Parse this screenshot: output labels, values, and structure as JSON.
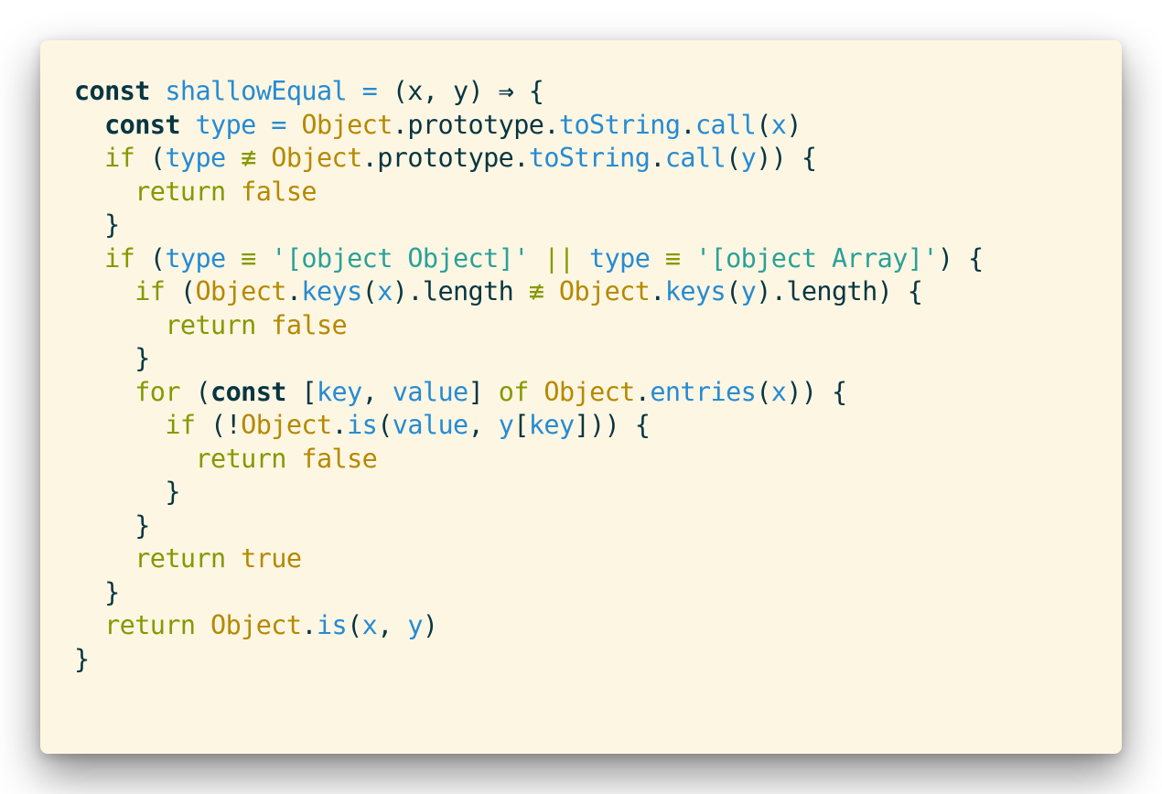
{
  "editor": {
    "language": "javascript",
    "theme": "solarized-light",
    "colors": {
      "background": "#fdf6e3",
      "keyword": "#073642",
      "control": "#859900",
      "object": "#b58900",
      "function": "#268bd2",
      "string": "#2aa198",
      "plain": "#073642"
    },
    "lines": [
      [
        [
          "kw",
          "const"
        ],
        [
          "pl",
          " "
        ],
        [
          "var",
          "shallowEqual"
        ],
        [
          "pl",
          " "
        ],
        [
          "fn",
          "="
        ],
        [
          "pl",
          " (x, y) "
        ],
        [
          "kw",
          "⇒"
        ],
        [
          "pl",
          " {"
        ]
      ],
      [
        [
          "pl",
          "  "
        ],
        [
          "kw",
          "const"
        ],
        [
          "pl",
          " "
        ],
        [
          "var",
          "type"
        ],
        [
          "pl",
          " "
        ],
        [
          "fn",
          "="
        ],
        [
          "pl",
          " "
        ],
        [
          "obj",
          "Object"
        ],
        [
          "pl",
          ".prototype."
        ],
        [
          "fn",
          "toString"
        ],
        [
          "pl",
          "."
        ],
        [
          "fn",
          "call"
        ],
        [
          "pl",
          "("
        ],
        [
          "var",
          "x"
        ],
        [
          "pl",
          ")"
        ]
      ],
      [
        [
          "pl",
          "  "
        ],
        [
          "ctl",
          "if"
        ],
        [
          "pl",
          " ("
        ],
        [
          "var",
          "type"
        ],
        [
          "pl",
          " "
        ],
        [
          "op",
          "≢"
        ],
        [
          "pl",
          " "
        ],
        [
          "obj",
          "Object"
        ],
        [
          "pl",
          ".prototype."
        ],
        [
          "fn",
          "toString"
        ],
        [
          "pl",
          "."
        ],
        [
          "fn",
          "call"
        ],
        [
          "pl",
          "("
        ],
        [
          "var",
          "y"
        ],
        [
          "pl",
          ")) {"
        ]
      ],
      [
        [
          "pl",
          "    "
        ],
        [
          "ctl",
          "return"
        ],
        [
          "pl",
          " "
        ],
        [
          "lit",
          "false"
        ]
      ],
      [
        [
          "pl",
          "  }"
        ]
      ],
      [
        [
          "pl",
          "  "
        ],
        [
          "ctl",
          "if"
        ],
        [
          "pl",
          " ("
        ],
        [
          "var",
          "type"
        ],
        [
          "pl",
          " "
        ],
        [
          "op",
          "≡"
        ],
        [
          "pl",
          " "
        ],
        [
          "str",
          "'[object Object]'"
        ],
        [
          "pl",
          " "
        ],
        [
          "op",
          "||"
        ],
        [
          "pl",
          " "
        ],
        [
          "var",
          "type"
        ],
        [
          "pl",
          " "
        ],
        [
          "op",
          "≡"
        ],
        [
          "pl",
          " "
        ],
        [
          "str",
          "'[object Array]'"
        ],
        [
          "pl",
          ") {"
        ]
      ],
      [
        [
          "pl",
          "    "
        ],
        [
          "ctl",
          "if"
        ],
        [
          "pl",
          " ("
        ],
        [
          "obj",
          "Object"
        ],
        [
          "pl",
          "."
        ],
        [
          "fn",
          "keys"
        ],
        [
          "pl",
          "("
        ],
        [
          "var",
          "x"
        ],
        [
          "pl",
          ").length "
        ],
        [
          "op",
          "≢"
        ],
        [
          "pl",
          " "
        ],
        [
          "obj",
          "Object"
        ],
        [
          "pl",
          "."
        ],
        [
          "fn",
          "keys"
        ],
        [
          "pl",
          "("
        ],
        [
          "var",
          "y"
        ],
        [
          "pl",
          ").length) {"
        ]
      ],
      [
        [
          "pl",
          "      "
        ],
        [
          "ctl",
          "return"
        ],
        [
          "pl",
          " "
        ],
        [
          "lit",
          "false"
        ]
      ],
      [
        [
          "pl",
          "    }"
        ]
      ],
      [
        [
          "pl",
          "    "
        ],
        [
          "ctl",
          "for"
        ],
        [
          "pl",
          " ("
        ],
        [
          "kw",
          "const"
        ],
        [
          "pl",
          " ["
        ],
        [
          "var",
          "key"
        ],
        [
          "pl",
          ", "
        ],
        [
          "var",
          "value"
        ],
        [
          "pl",
          "] "
        ],
        [
          "ctl",
          "of"
        ],
        [
          "pl",
          " "
        ],
        [
          "obj",
          "Object"
        ],
        [
          "pl",
          "."
        ],
        [
          "fn",
          "entries"
        ],
        [
          "pl",
          "("
        ],
        [
          "var",
          "x"
        ],
        [
          "pl",
          ")) {"
        ]
      ],
      [
        [
          "pl",
          "      "
        ],
        [
          "ctl",
          "if"
        ],
        [
          "pl",
          " (!"
        ],
        [
          "obj",
          "Object"
        ],
        [
          "pl",
          "."
        ],
        [
          "fn",
          "is"
        ],
        [
          "pl",
          "("
        ],
        [
          "var",
          "value"
        ],
        [
          "pl",
          ", "
        ],
        [
          "var",
          "y"
        ],
        [
          "pl",
          "["
        ],
        [
          "var",
          "key"
        ],
        [
          "pl",
          "])) {"
        ]
      ],
      [
        [
          "pl",
          "        "
        ],
        [
          "ctl",
          "return"
        ],
        [
          "pl",
          " "
        ],
        [
          "lit",
          "false"
        ]
      ],
      [
        [
          "pl",
          "      }"
        ]
      ],
      [
        [
          "pl",
          "    }"
        ]
      ],
      [
        [
          "pl",
          "    "
        ],
        [
          "ctl",
          "return"
        ],
        [
          "pl",
          " "
        ],
        [
          "lit",
          "true"
        ]
      ],
      [
        [
          "pl",
          "  }"
        ]
      ],
      [
        [
          "pl",
          "  "
        ],
        [
          "ctl",
          "return"
        ],
        [
          "pl",
          " "
        ],
        [
          "obj",
          "Object"
        ],
        [
          "pl",
          "."
        ],
        [
          "fn",
          "is"
        ],
        [
          "pl",
          "("
        ],
        [
          "var",
          "x"
        ],
        [
          "pl",
          ", "
        ],
        [
          "var",
          "y"
        ],
        [
          "pl",
          ")"
        ]
      ],
      [
        [
          "pl",
          "}"
        ]
      ]
    ]
  }
}
